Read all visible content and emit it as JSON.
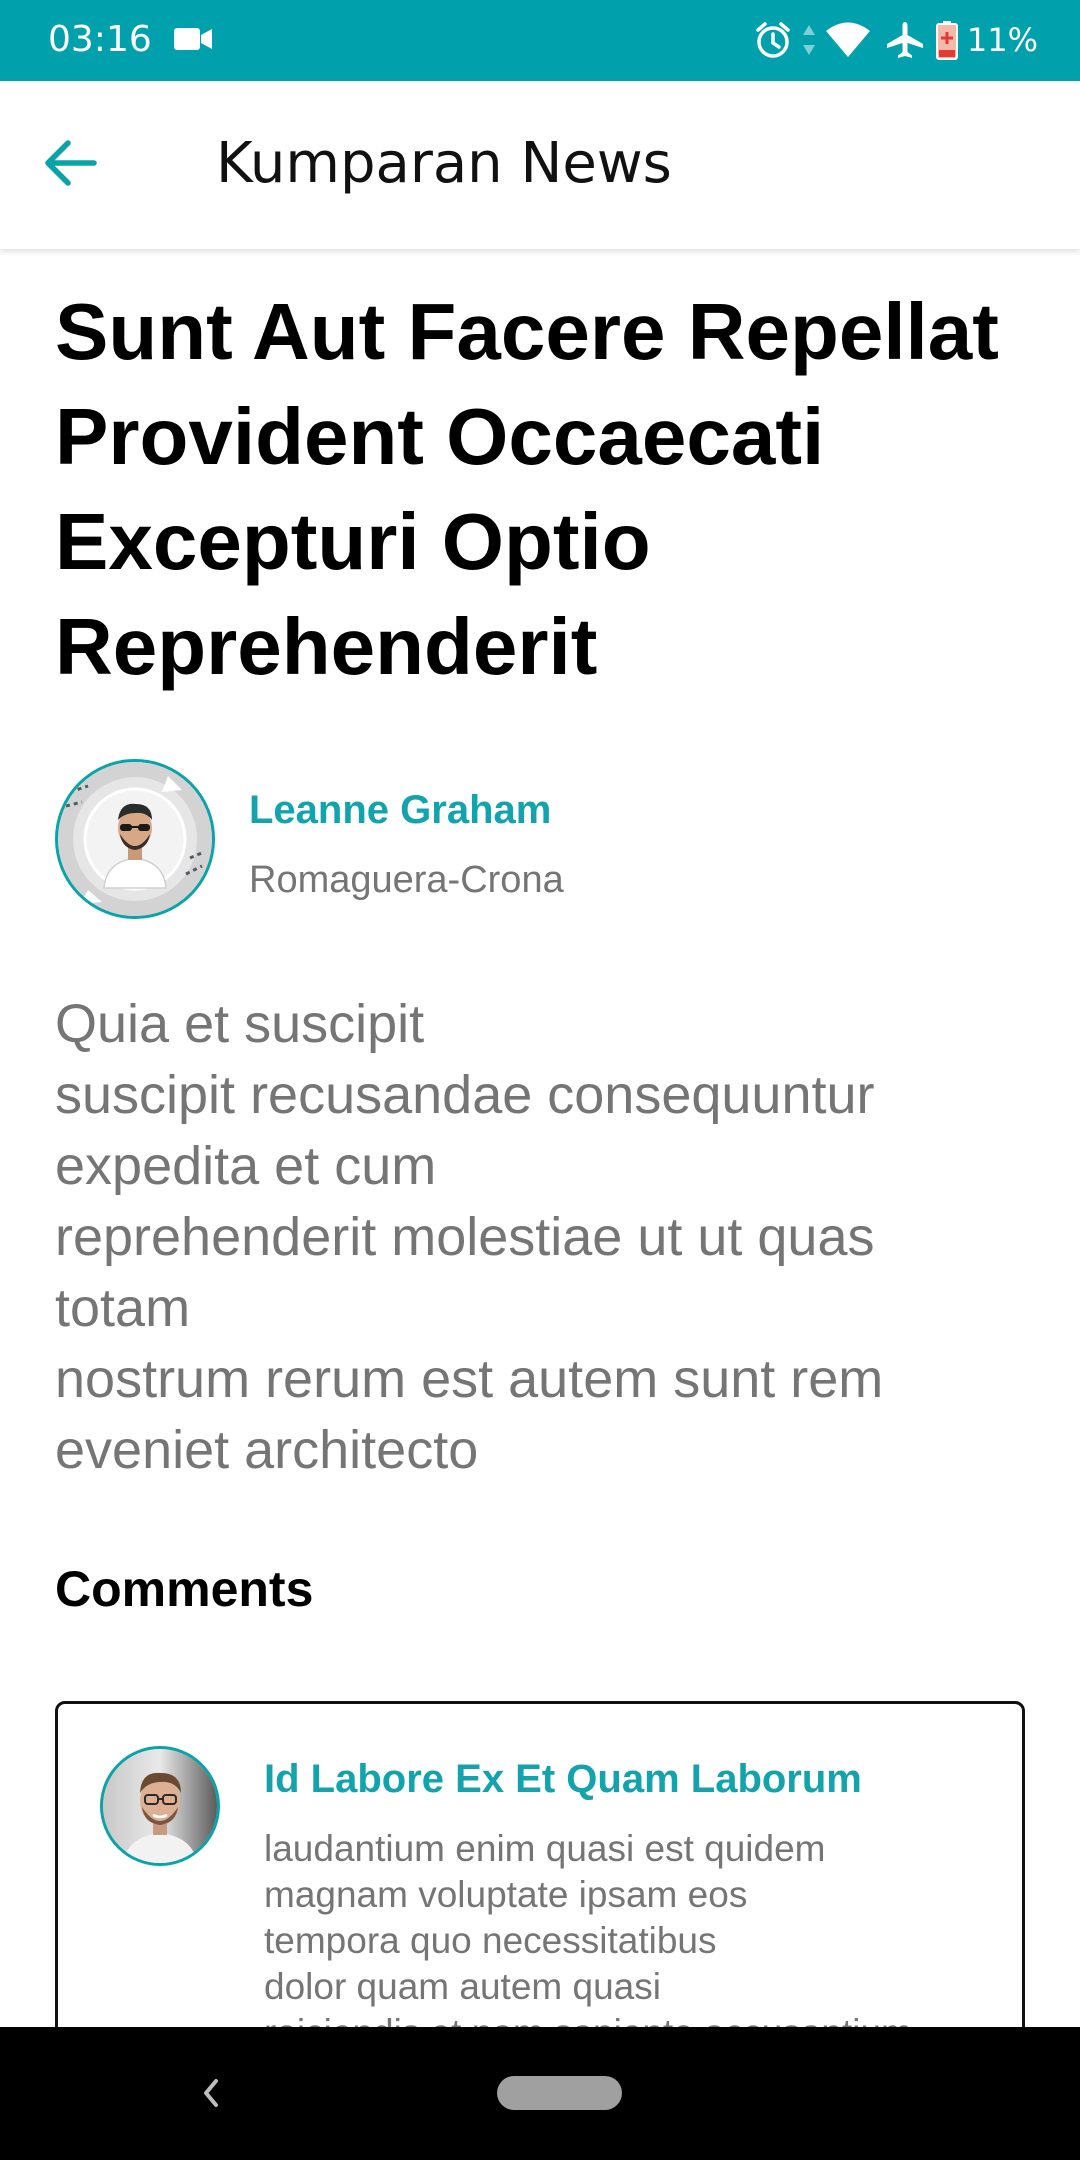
{
  "status_bar": {
    "time": "03:16",
    "battery_percent": "11%",
    "icons": [
      "video-camera-icon",
      "alarm-icon",
      "data-arrows-icon",
      "wifi-icon",
      "airplane-icon",
      "battery-low-icon"
    ],
    "background_color": "#00a1ad"
  },
  "app_bar": {
    "title": "Kumparan News",
    "back_icon": "arrow-left-icon",
    "accent_color": "#0aa3a8"
  },
  "article": {
    "title": "Sunt Aut Facere Repellat Provident Occaecati Excepturi Optio Reprehenderit",
    "author": {
      "name": "Leanne Graham",
      "company": "Romaguera-Crona"
    },
    "body": "Quia et suscipit\nsuscipit recusandae consequuntur expedita et cum\nreprehenderit molestiae ut ut quas totam\nnostrum rerum est autem sunt rem eveniet architecto"
  },
  "comments": {
    "heading": "Comments",
    "items": [
      {
        "title": "Id Labore Ex Et Quam Laborum",
        "body": "laudantium enim quasi est quidem\nmagnam voluptate ipsam eos\ntempora quo necessitatibus\ndolor quam autem quasi\nreiciendis et nam sapiente accusantium"
      }
    ]
  },
  "nav_bar": {
    "icons": [
      "nav-back-icon",
      "nav-home-pill"
    ]
  }
}
